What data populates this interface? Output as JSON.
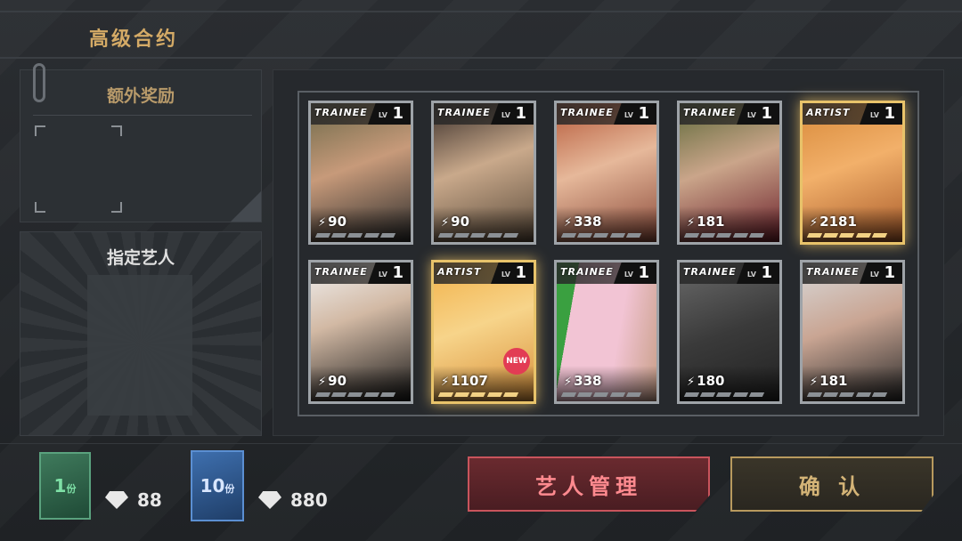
{
  "title": "高级合约",
  "bonus": {
    "title": "额外奖励"
  },
  "designate": {
    "title": "指定艺人"
  },
  "cards": [
    {
      "rank": "TRAINEE",
      "lv_tag": "LV",
      "level": "1",
      "power": "90",
      "tier": "silver",
      "is_new": false
    },
    {
      "rank": "TRAINEE",
      "lv_tag": "LV",
      "level": "1",
      "power": "90",
      "tier": "silver",
      "is_new": false
    },
    {
      "rank": "TRAINEE",
      "lv_tag": "LV",
      "level": "1",
      "power": "338",
      "tier": "silver",
      "is_new": false
    },
    {
      "rank": "TRAINEE",
      "lv_tag": "LV",
      "level": "1",
      "power": "181",
      "tier": "silver",
      "is_new": false
    },
    {
      "rank": "ARTIST",
      "lv_tag": "LV",
      "level": "1",
      "power": "2181",
      "tier": "gold",
      "is_new": false
    },
    {
      "rank": "TRAINEE",
      "lv_tag": "LV",
      "level": "1",
      "power": "90",
      "tier": "silver",
      "is_new": false
    },
    {
      "rank": "ARTIST",
      "lv_tag": "LV",
      "level": "1",
      "power": "1107",
      "tier": "gold",
      "is_new": true,
      "new_label": "NEW"
    },
    {
      "rank": "TRAINEE",
      "lv_tag": "LV",
      "level": "1",
      "power": "338",
      "tier": "silver",
      "is_new": false
    },
    {
      "rank": "TRAINEE",
      "lv_tag": "LV",
      "level": "1",
      "power": "180",
      "tier": "silver",
      "is_new": false
    },
    {
      "rank": "TRAINEE",
      "lv_tag": "LV",
      "level": "1",
      "power": "181",
      "tier": "silver",
      "is_new": false
    }
  ],
  "packs": [
    {
      "count": "1",
      "unit": "份",
      "price": "88"
    },
    {
      "count": "10",
      "unit": "份",
      "price": "880"
    }
  ],
  "buttons": {
    "manage": "艺人管理",
    "confirm": "确 认"
  },
  "colors": {
    "title_gold": "#d4aa66",
    "manage_red": "#c9545c",
    "confirm_gold": "#b89a5e"
  }
}
